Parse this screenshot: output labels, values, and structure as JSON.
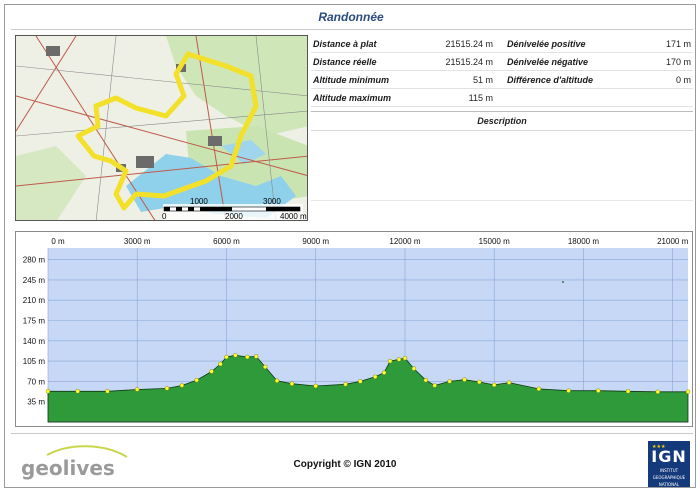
{
  "header": {
    "title": "Randonnée"
  },
  "map": {
    "scale_top": [
      "1000",
      "3000"
    ],
    "scale_bottom": [
      "0",
      "2000",
      "4000 m"
    ],
    "route_color": "#f2e02a"
  },
  "stats": {
    "rows": [
      {
        "l1": "Distance à plat",
        "v1": "21515.24 m",
        "l2": "Dénivelée positive",
        "v2": "171 m"
      },
      {
        "l1": "Distance réelle",
        "v1": "21515.24 m",
        "l2": "Dénivelée négative",
        "v2": "170 m"
      },
      {
        "l1": "Altitude minimum",
        "v1": "51 m",
        "l2": "Différence d'altitude",
        "v2": "0 m"
      },
      {
        "l1": "Altitude maximum",
        "v1": "115 m",
        "l2": "",
        "v2": ""
      }
    ],
    "description_label": "Description"
  },
  "profile": {
    "x_ticks": [
      "0 m",
      "3000 m",
      "6000 m",
      "9000 m",
      "12000 m",
      "15000 m",
      "18000 m",
      "21000 m"
    ],
    "y_ticks": [
      "280 m",
      "245 m",
      "210 m",
      "175 m",
      "140 m",
      "105 m",
      "70 m",
      "35 m"
    ],
    "fill_color": "#2e9a3a",
    "background_color": "#c6d8f5",
    "marker_color": "#ffff33"
  },
  "chart_data": {
    "type": "area",
    "title": "",
    "xlabel": "",
    "ylabel": "",
    "xlim": [
      0,
      21515
    ],
    "ylim": [
      0,
      300
    ],
    "x": [
      0,
      1000,
      2000,
      3000,
      4000,
      4500,
      5000,
      5500,
      5800,
      6000,
      6300,
      6700,
      7000,
      7300,
      7700,
      8200,
      9000,
      10000,
      10500,
      11000,
      11300,
      11500,
      11800,
      12000,
      12300,
      12700,
      13000,
      13500,
      14000,
      14500,
      15000,
      15500,
      16500,
      17500,
      18500,
      19500,
      20500,
      21515
    ],
    "y": [
      53,
      53,
      53,
      56,
      58,
      63,
      72,
      87,
      100,
      112,
      115,
      112,
      113,
      95,
      71,
      66,
      62,
      65,
      70,
      78,
      85,
      105,
      108,
      110,
      92,
      72,
      63,
      70,
      73,
      69,
      64,
      68,
      57,
      54,
      54,
      53,
      52,
      52
    ]
  },
  "footer": {
    "logo_text": "geolives",
    "copyright": "Copyright © IGN 2010",
    "ign_word": "IGN",
    "ign_sub": [
      "INSTITUT",
      "GEOGRAPHIQUE",
      "NATIONAL"
    ]
  }
}
